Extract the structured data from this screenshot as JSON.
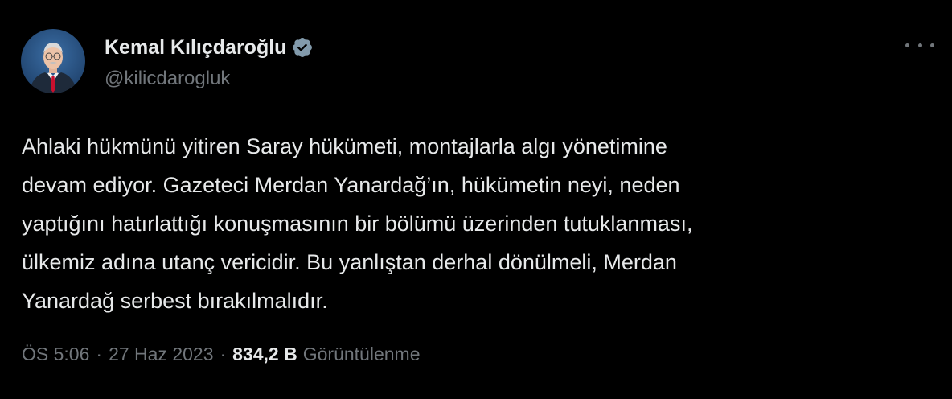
{
  "author": {
    "display_name": "Kemal Kılıçdaroğlu",
    "handle": "@kilicdarogluk",
    "verified_icon": "verified-badge-icon",
    "avatar": "profile-photo"
  },
  "tweet": {
    "text": "Ahlaki hükmünü yitiren Saray hükümeti, montajlarla algı yönetimine\ndevam ediyor. Gazeteci Merdan Yanardağ’ın, hükümetin neyi, neden\nyaptığını hatırlattığı konuşmasının bir bölümü üzerinden tutuklanması,\nülkemiz adına utanç vericidir. Bu yanlıştan derhal dönülmeli, Merdan\nYanardağ serbest bırakılmalıdır."
  },
  "meta": {
    "time": "ÖS 5:06",
    "separator": "·",
    "date": "27 Haz 2023",
    "views_count": "834,2 B",
    "views_label": "Görüntülenme"
  },
  "colors": {
    "background": "#000000",
    "text_primary": "#e7e9ea",
    "text_secondary": "#71767b",
    "verified": "#829aab"
  },
  "icons": {
    "more": "more-horizontal-icon"
  }
}
